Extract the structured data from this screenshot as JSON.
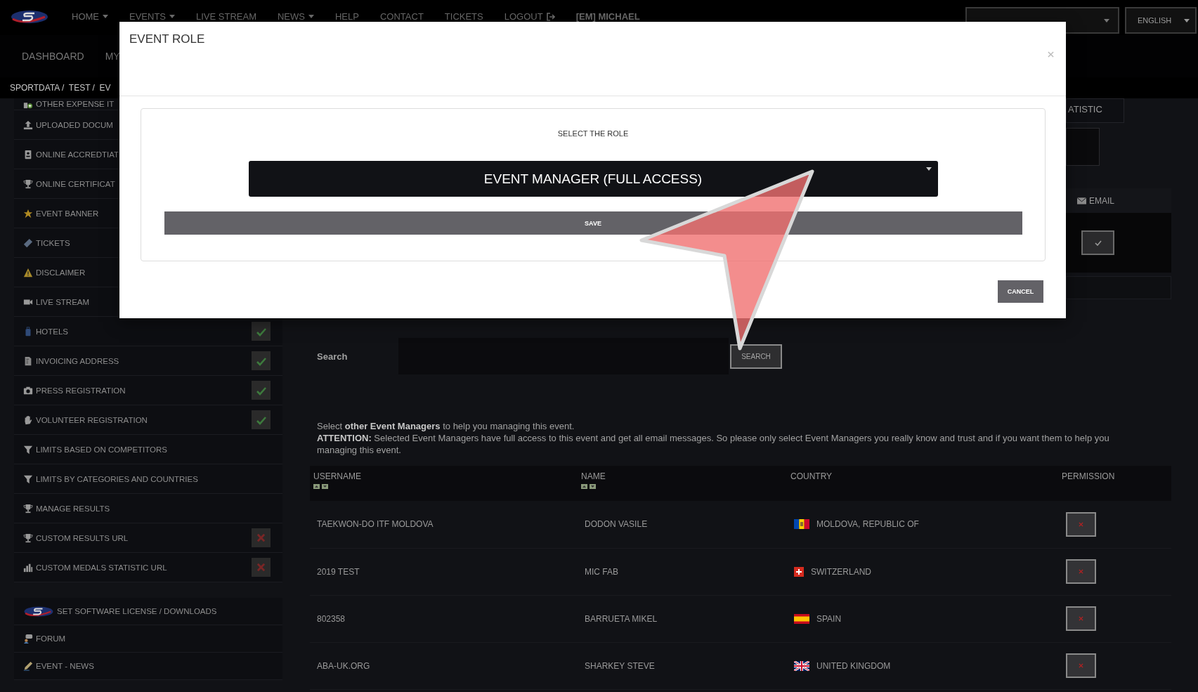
{
  "top_nav": {
    "items": [
      {
        "label": "HOME",
        "kind": "dropdown"
      },
      {
        "label": "EVENTS",
        "kind": "dropdown"
      },
      {
        "label": "LIVE STREAM",
        "kind": "link"
      },
      {
        "label": "NEWS",
        "kind": "dropdown"
      },
      {
        "label": "HELP",
        "kind": "link"
      },
      {
        "label": "CONTACT",
        "kind": "link"
      },
      {
        "label": "TICKETS",
        "kind": "link"
      },
      {
        "label": "LOGOUT",
        "kind": "logout"
      },
      {
        "label": "[EM] MICHAEL",
        "kind": "user"
      }
    ],
    "language": "ENGLISH"
  },
  "sub_nav": {
    "items": [
      "DASHBOARD",
      "MY"
    ]
  },
  "breadcrumb": "SPORTDATA /  TEST /  EV",
  "sidebar": {
    "items": [
      {
        "label": "OTHER EXPENSE IT"
      },
      {
        "label": "UPLOADED DOCUM"
      },
      {
        "label": "ONLINE ACCREDTIAT"
      },
      {
        "label": "ONLINE CERTIFICAT"
      },
      {
        "label": "EVENT BANNER"
      },
      {
        "label": "TICKETS"
      },
      {
        "label": "DISCLAIMER"
      },
      {
        "label": "LIVE STREAM"
      },
      {
        "label": "HOTELS",
        "enabled": true
      },
      {
        "label": "INVOICING ADDRESS",
        "enabled": true
      },
      {
        "label": "PRESS REGISTRATION",
        "enabled": true
      },
      {
        "label": "VOLUNTEER REGISTRATION",
        "enabled": true
      },
      {
        "label": "LIMITS BASED ON COMPETITORS"
      },
      {
        "label": "LIMITS BY CATEGORIES AND COUNTRIES"
      },
      {
        "label": "MANAGE RESULTS"
      },
      {
        "label": "CUSTOM RESULTS URL",
        "enabled": false
      },
      {
        "label": "CUSTOM MEDALS STATISTIC URL",
        "enabled": false
      }
    ],
    "bottom_items": [
      {
        "label": "SET SOFTWARE LICENSE / DOWNLOADS"
      },
      {
        "label": "FORUM"
      },
      {
        "label": "EVENT - NEWS"
      }
    ]
  },
  "side_panel": {
    "tab": "ATISTIC",
    "column": "EMAIL",
    "checked": true
  },
  "search": {
    "label": "Search",
    "button": "SEARCH"
  },
  "intro": [
    "Select **other Event Managers** to help you managing this event.",
    "**ATTENTION:** Selected Event Managers have full access to this event and get all email messages. So please only select Event Managers you really know and trust and if you want them to help you managing this event."
  ],
  "table": {
    "columns": [
      {
        "label": "USERNAME",
        "sortable": true
      },
      {
        "label": "NAME",
        "sortable": true
      },
      {
        "label": "COUNTRY",
        "sortable": false
      },
      {
        "label": "PERMISSION",
        "sortable": false
      }
    ],
    "rows": [
      {
        "username": "TAEKWON-DO ITF MOLDOVA",
        "name": "DODON VASILE",
        "country": "MOLDOVA, REPUBLIC OF",
        "granted": false
      },
      {
        "username": "2019 TEST",
        "name": "MIC FAB",
        "country": "SWITZERLAND",
        "granted": false
      },
      {
        "username": "802358",
        "name": "BARRUETA MIKEL",
        "country": "SPAIN",
        "granted": false
      },
      {
        "username": "ABA-UK.ORG",
        "name": "SHARKEY STEVE",
        "country": "UNITED KINGDOM",
        "granted": false
      }
    ]
  },
  "modal": {
    "title": "EVENT ROLE",
    "prompt": "SELECT THE ROLE",
    "role": "EVENT MANAGER (FULL ACCESS)",
    "save": "SAVE",
    "cancel": "CANCEL"
  }
}
